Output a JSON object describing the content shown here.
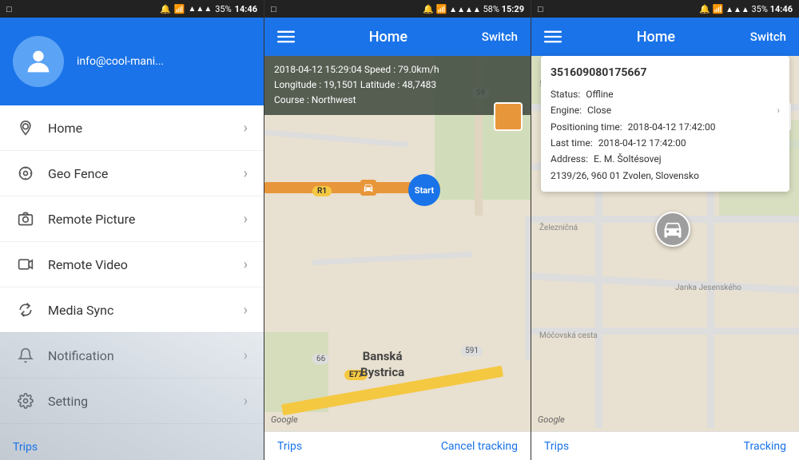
{
  "panel1": {
    "statusBar": {
      "left": "□",
      "time": "14:46",
      "battery": "35%",
      "icons": "🔔 📶 📶"
    },
    "header": {
      "email": "info@cool-mani..."
    },
    "menuItems": [
      {
        "id": "home",
        "label": "Home",
        "icon": "location"
      },
      {
        "id": "geo-fence",
        "label": "Geo Fence",
        "icon": "fence"
      },
      {
        "id": "remote-picture",
        "label": "Remote Picture",
        "icon": "camera"
      },
      {
        "id": "remote-video",
        "label": "Remote Video",
        "icon": "video"
      },
      {
        "id": "media-sync",
        "label": "Media Sync",
        "icon": "sync"
      },
      {
        "id": "notification",
        "label": "Notification",
        "icon": "bell"
      },
      {
        "id": "setting",
        "label": "Setting",
        "icon": "info"
      }
    ],
    "tripsLabel": "Trips"
  },
  "panel2": {
    "statusBar": {
      "left": "□",
      "time": "15:29",
      "battery": "58%"
    },
    "appBar": {
      "title": "Home",
      "switchLabel": "Switch"
    },
    "infoOverlay": {
      "line1": "2018-04-12 15:29:04   Speed : 79.0km/h",
      "line2": "Longitude : 19,1501   Latitude : 48,7483",
      "line3": "Course : Northwest"
    },
    "mapLabels": {
      "city": "Banská\nBystrica",
      "google": "Google",
      "start": "Start"
    },
    "bottomBar": {
      "trips": "Trips",
      "cancelTracking": "Cancel tracking"
    }
  },
  "panel3": {
    "statusBar": {
      "left": "□",
      "time": "14:46",
      "battery": "35%"
    },
    "appBar": {
      "title": "Home",
      "switchLabel": "Switch"
    },
    "deviceInfo": {
      "deviceId": "351609080175667",
      "statusLabel": "Status:",
      "statusValue": "Offline",
      "engineLabel": "Engine:",
      "engineValue": "Close",
      "positioningLabel": "Positioning time:",
      "positioningValue": "2018-04-12 17:42:00",
      "lastTimeLabel": "Last time:",
      "lastTimeValue": "2018-04-12 17:42:00",
      "addressLabel": "Address:",
      "addressValue": "E. M. Šoltésovej\n2139/26, 960 01 Zvolen, Slovensko"
    },
    "mapLabels": {
      "google": "Google"
    },
    "bottomBar": {
      "trips": "Trips",
      "tracking": "Tracking"
    }
  }
}
